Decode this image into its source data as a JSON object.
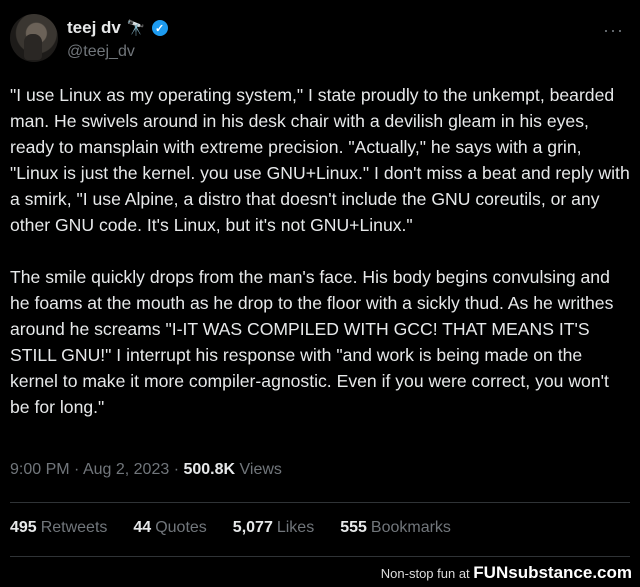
{
  "author": {
    "display_name": "teej dv",
    "emoji": "🔭",
    "handle": "@teej_dv"
  },
  "more_label": "···",
  "tweet": {
    "text": "\"I use Linux as my operating system,\" I state proudly to the unkempt, bearded man. He swivels around in his desk chair with a devilish gleam in his eyes, ready to mansplain with extreme precision. \"Actually,\" he says with a grin, \"Linux is just the kernel. you use GNU+Linux.\" I don't miss a beat and reply with a smirk, \"I use Alpine, a distro that doesn't include the GNU coreutils, or any other GNU code. It's Linux, but it's not GNU+Linux.\"\n\nThe smile quickly drops from the man's face. His body begins convulsing and he foams at the mouth as he drop to the floor with a sickly thud. As he writhes around he screams \"I-IT WAS COMPILED WITH GCC! THAT MEANS IT'S STILL GNU!\" I interrupt his response with \"and work is being made on the kernel to make it more compiler-agnostic. Even if you were correct, you won't be for long.\""
  },
  "meta": {
    "time": "9:00 PM",
    "sep": "·",
    "date": "Aug 2, 2023",
    "views_count": "500.8K",
    "views_label": "Views"
  },
  "stats": {
    "retweets_count": "495",
    "retweets_label": "Retweets",
    "quotes_count": "44",
    "quotes_label": "Quotes",
    "likes_count": "5,077",
    "likes_label": "Likes",
    "bookmarks_count": "555",
    "bookmarks_label": "Bookmarks"
  },
  "footer": {
    "caption": "Non-stop fun at",
    "brand": "FUNsubstance.com"
  },
  "colors": {
    "background": "#000000",
    "text": "#e7e9ea",
    "muted": "#71767b",
    "verified": "#1d9bf0"
  }
}
